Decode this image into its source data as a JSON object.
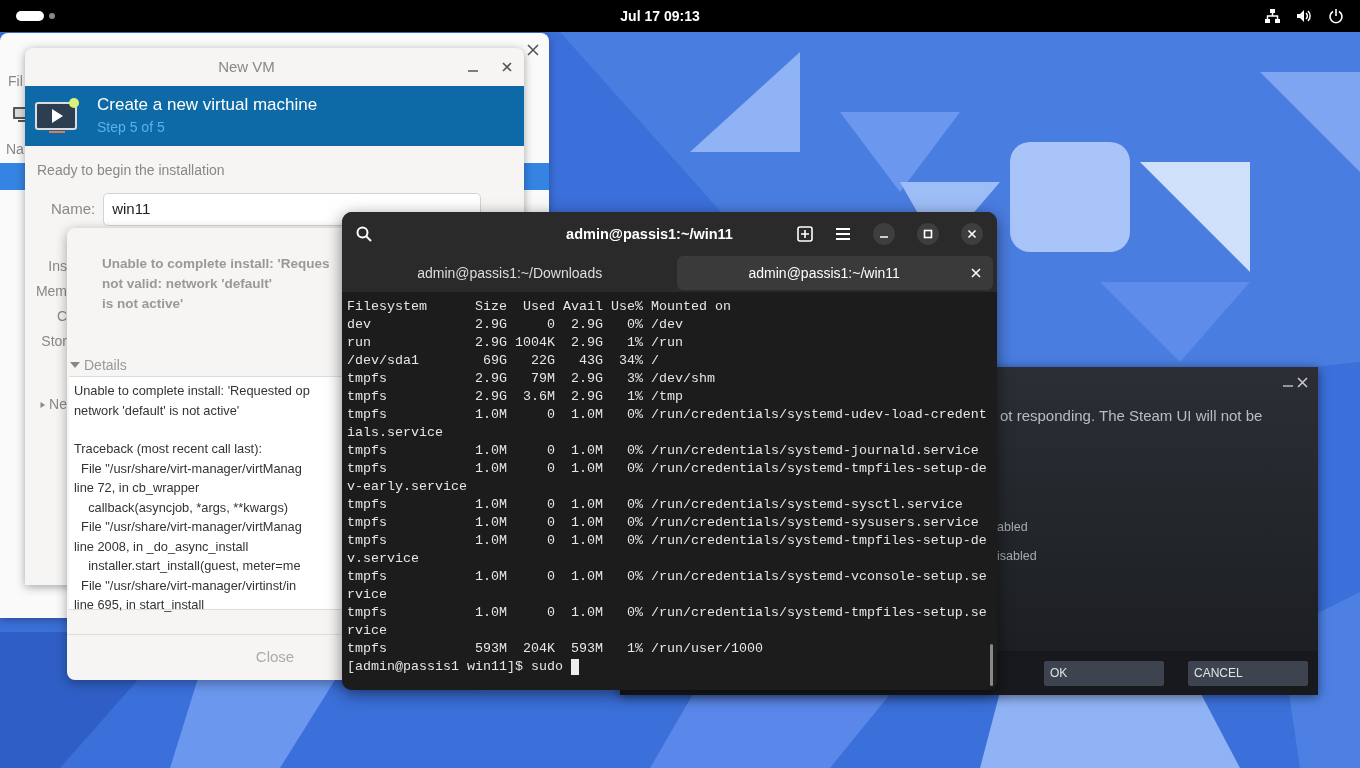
{
  "top_bar": {
    "clock": "Jul 17  09:13"
  },
  "vm_manager": {
    "menu_item": "Fil",
    "column_header": "Na"
  },
  "new_vm": {
    "title": "New VM",
    "banner_title": "Create a new virtual machine",
    "banner_step": "Step 5 of 5",
    "ready_text": "Ready to begin the installation",
    "name_label": "Name:",
    "name_value": "win11",
    "side_labels": [
      "Ins",
      "Mem",
      "C",
      "Stor"
    ],
    "expander_label": "Ne",
    "expander_expanded": false
  },
  "error_dialog": {
    "message": "Unable to complete install: 'Reques\nnot valid: network 'default'\nis not active'",
    "details_label": "Details",
    "details_expanded": true,
    "details_paragraphs": [
      "Unable to complete install: 'Requested op\nnetwork 'default' is not active'",
      "Traceback (most recent call last):\n  File \"/usr/share/virt-manager/virtManag\nline 72, in cb_wrapper\n    callback(asyncjob, *args, **kwargs)\n  File \"/usr/share/virt-manager/virtManag\nline 2008, in _do_async_install\n    installer.start_install(guest, meter=me\n  File \"/usr/share/virt-manager/virtinst/in\nline 695, in start_install"
    ],
    "close_button": "Close"
  },
  "steam_dialog": {
    "message": "ot responding. The Steam UI will not be",
    "options": [
      "abled",
      "isabled"
    ],
    "buttons": [
      "OK",
      "CANCEL"
    ]
  },
  "terminal": {
    "title": "admin@passis1:~/win11",
    "tabs": [
      {
        "label": "admin@passis1:~/Downloads",
        "selected": false
      },
      {
        "label": "admin@passis1:~/win11",
        "selected": true
      }
    ],
    "lines": [
      "Filesystem      Size  Used Avail Use% Mounted on",
      "dev             2.9G     0  2.9G   0% /dev",
      "run             2.9G 1004K  2.9G   1% /run",
      "/dev/sda1        69G   22G   43G  34% /",
      "tmpfs           2.9G   79M  2.9G   3% /dev/shm",
      "tmpfs           2.9G  3.6M  2.9G   1% /tmp",
      "tmpfs           1.0M     0  1.0M   0% /run/credentials/systemd-udev-load-credent",
      "ials.service",
      "tmpfs           1.0M     0  1.0M   0% /run/credentials/systemd-journald.service",
      "tmpfs           1.0M     0  1.0M   0% /run/credentials/systemd-tmpfiles-setup-de",
      "v-early.service",
      "tmpfs           1.0M     0  1.0M   0% /run/credentials/systemd-sysctl.service",
      "tmpfs           1.0M     0  1.0M   0% /run/credentials/systemd-sysusers.service",
      "tmpfs           1.0M     0  1.0M   0% /run/credentials/systemd-tmpfiles-setup-de",
      "v.service",
      "tmpfs           1.0M     0  1.0M   0% /run/credentials/systemd-vconsole-setup.se",
      "rvice",
      "tmpfs           1.0M     0  1.0M   0% /run/credentials/systemd-tmpfiles-setup.se",
      "rvice",
      "tmpfs           593M  204K  593M   1% /run/user/1000"
    ],
    "prompt": "[admin@passis1 win11]$ sudo"
  }
}
